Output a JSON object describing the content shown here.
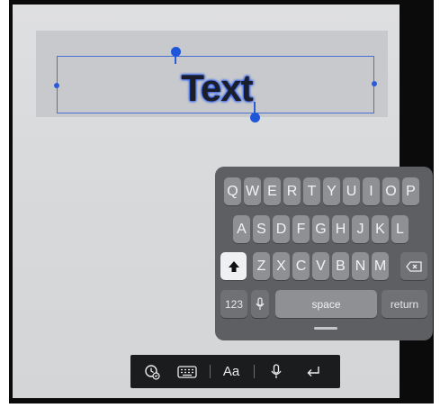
{
  "canvas": {
    "text_object": "Text"
  },
  "keyboard": {
    "row1": [
      "Q",
      "W",
      "E",
      "R",
      "T",
      "Y",
      "U",
      "I",
      "O",
      "P"
    ],
    "row2": [
      "A",
      "S",
      "D",
      "F",
      "G",
      "H",
      "J",
      "K",
      "L"
    ],
    "row3": [
      "Z",
      "X",
      "C",
      "V",
      "B",
      "N",
      "M"
    ],
    "numbers_label": "123",
    "space_label": "space",
    "return_label": "return",
    "icons": {
      "shift": "shift-icon",
      "backspace": "backspace-icon",
      "dictation": "microphone-icon"
    }
  },
  "toolbar": {
    "format_label": "Aa",
    "icons": [
      "emoji-clock-icon",
      "keyboard-icon",
      "format-icon",
      "microphone-icon",
      "return-icon"
    ]
  },
  "colors": {
    "selection": "#2a5bd8",
    "keyboard_bg": "#5d5f62",
    "key": "#8e9094",
    "toolbar_bg": "#1b1c1e"
  }
}
